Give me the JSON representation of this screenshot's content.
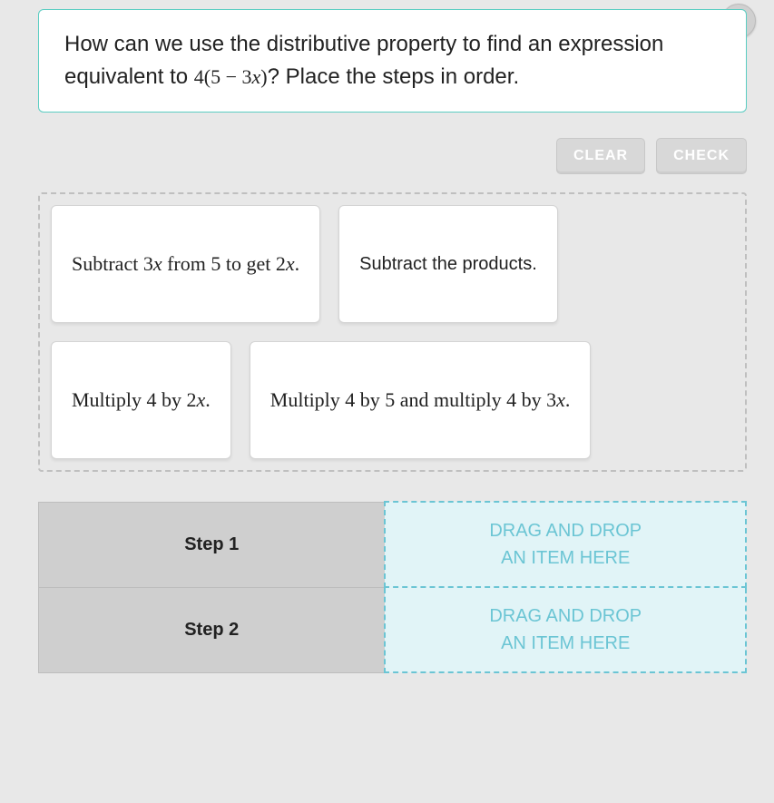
{
  "question": {
    "prefix": "How can we use the distributive property to find an expression equivalent to ",
    "expression_html": "4(5 − 3<span class='var'>x</span>)",
    "suffix": "? Place the steps in order."
  },
  "buttons": {
    "clear": "CLEAR",
    "check": "CHECK"
  },
  "choices": [
    {
      "html": "Subtract 3<span class='var'>x</span> from 5 to get 2<span class='var'>x</span>."
    },
    {
      "html": "Subtract the products."
    },
    {
      "html": "Multiply 4 by 2<span class='var'>x</span>."
    },
    {
      "html": "Multiply 4 by 5 and multiply 4 by 3<span class='var'>x</span>."
    }
  ],
  "steps": [
    {
      "label": "Step 1",
      "drop_line1": "DRAG AND DROP",
      "drop_line2": "AN ITEM HERE"
    },
    {
      "label": "Step 2",
      "drop_line1": "DRAG AND DROP",
      "drop_line2": "AN ITEM HERE"
    }
  ]
}
